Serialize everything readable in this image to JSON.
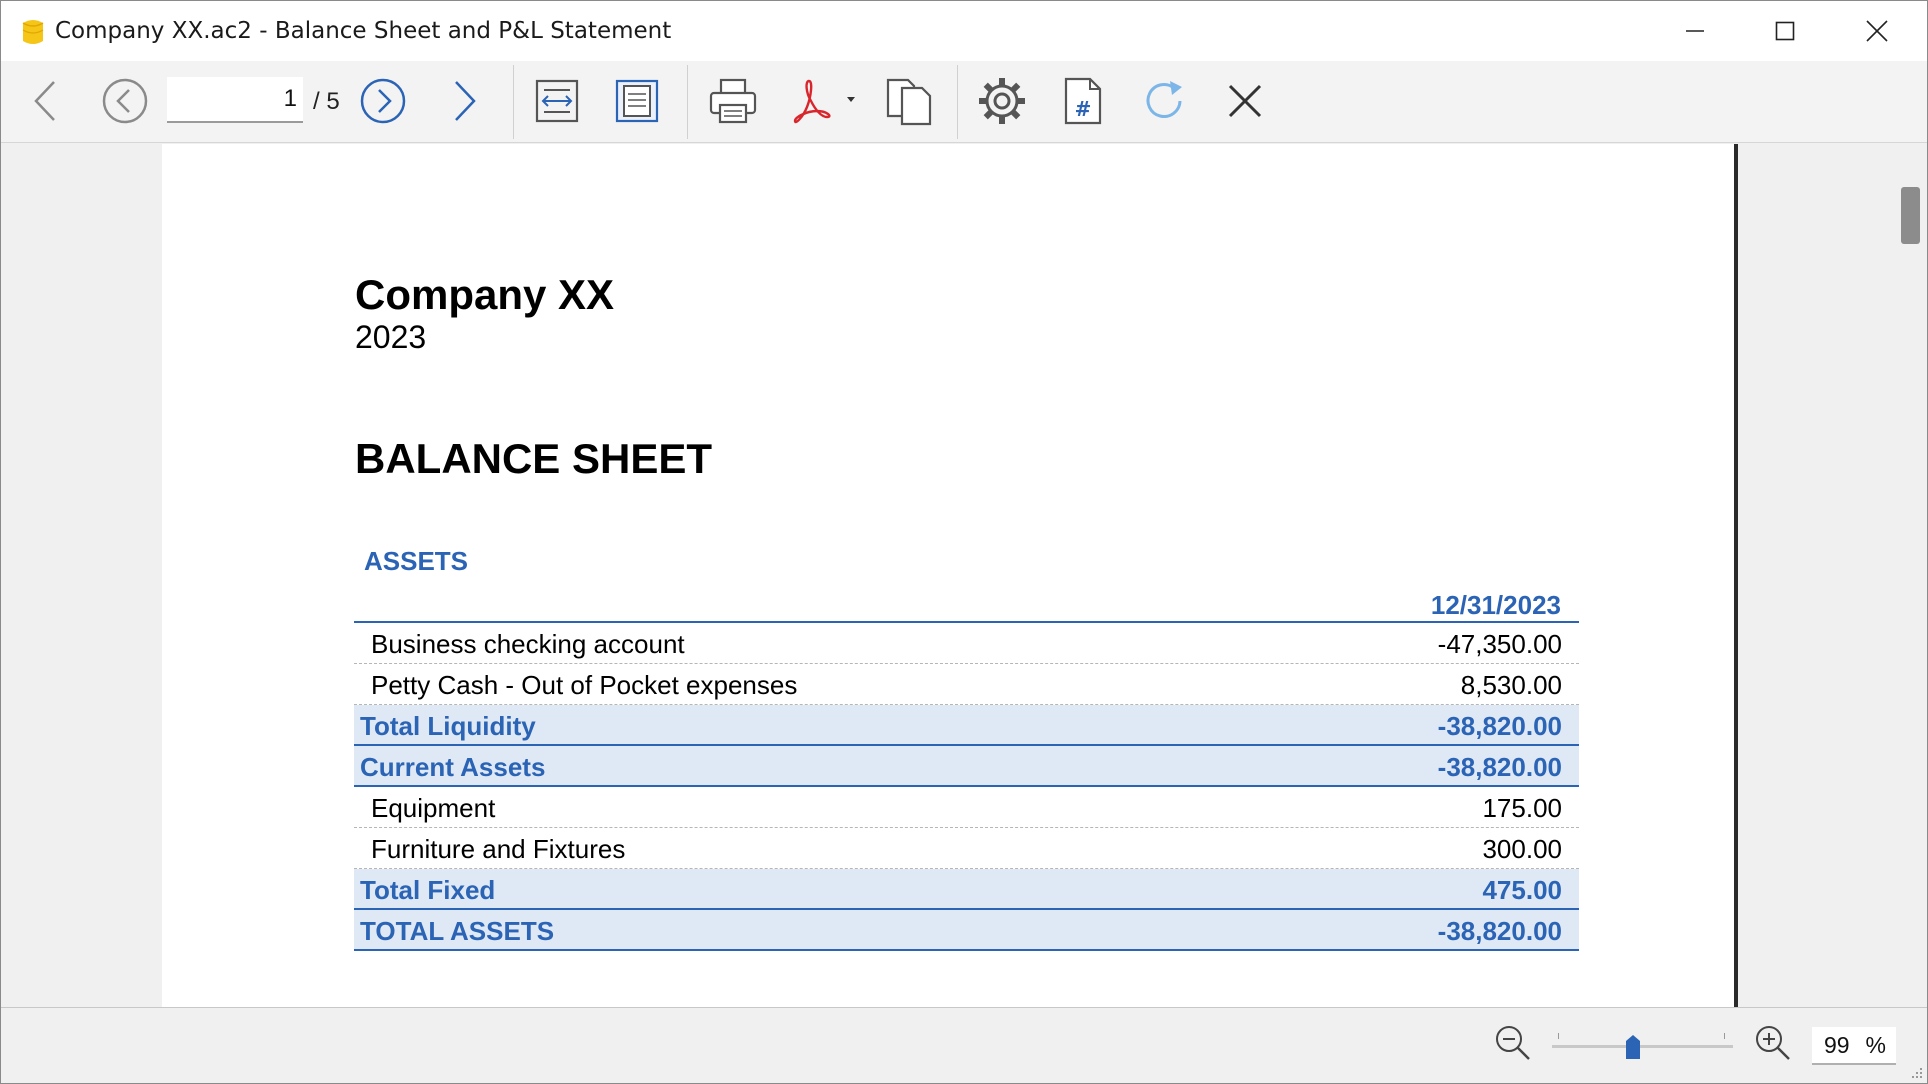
{
  "window": {
    "title": "Company XX.ac2 - Balance Sheet and P&L Statement",
    "controls": {
      "minimize": "minimize-icon",
      "maximize": "maximize-icon",
      "close": "close-icon"
    }
  },
  "toolbar": {
    "current_page": "1",
    "page_total": "/ 5",
    "icons": [
      "back-arrow-icon",
      "previous-page-icon",
      "next-page-icon",
      "forward-arrow-icon",
      "fit-width-icon",
      "fit-page-icon",
      "print-icon",
      "pdf-export-icon",
      "copy-pages-icon",
      "settings-gear-icon",
      "page-number-icon",
      "refresh-icon",
      "close-preview-icon"
    ]
  },
  "document": {
    "company": "Company XX",
    "year": "2023",
    "report_title": "BALANCE SHEET",
    "section_title": "ASSETS",
    "column_header": "12/31/2023",
    "rows": [
      {
        "label": "Business checking account",
        "amount": "-47,350.00",
        "type": "line"
      },
      {
        "label": "Petty Cash - Out of Pocket expenses",
        "amount": "8,530.00",
        "type": "line"
      },
      {
        "label": "Total Liquidity",
        "amount": "-38,820.00",
        "type": "total"
      },
      {
        "label": "Current Assets",
        "amount": "-38,820.00",
        "type": "total"
      },
      {
        "label": "Equipment",
        "amount": "175.00",
        "type": "line"
      },
      {
        "label": "Furniture and Fixtures",
        "amount": "300.00",
        "type": "line"
      },
      {
        "label": "Total Fixed",
        "amount": "475.00",
        "type": "total"
      },
      {
        "label": "TOTAL ASSETS",
        "amount": "-38,820.00",
        "type": "total"
      }
    ]
  },
  "statusbar": {
    "zoom_value": "99",
    "zoom_unit": "%",
    "zoom_level": 0.45
  },
  "colors": {
    "accent_blue": "#2b63b5",
    "total_row_bg": "#dfe9f5",
    "app_icon_yellow": "#f5c518"
  }
}
